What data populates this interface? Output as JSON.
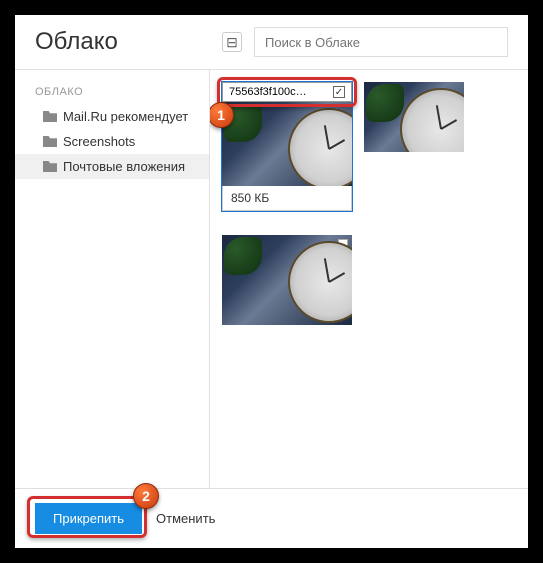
{
  "header": {
    "title": "Облако",
    "collapse_symbol": "⊟",
    "search_placeholder": "Поиск в Облаке"
  },
  "sidebar": {
    "section_label": "ОБЛАКО",
    "items": [
      {
        "label": "Mail.Ru рекомендует"
      },
      {
        "label": "Screenshots"
      },
      {
        "label": "Почтовые вложения"
      }
    ]
  },
  "files": [
    {
      "name": "75563f3f100c…",
      "size": "850 КБ",
      "selected": true
    },
    {
      "name": "",
      "size": "",
      "selected": false
    },
    {
      "name": "",
      "size": "",
      "selected": false
    }
  ],
  "footer": {
    "attach": "Прикрепить",
    "cancel": "Отменить"
  },
  "callouts": {
    "one": "1",
    "two": "2"
  },
  "colors": {
    "primary": "#168de2",
    "highlight": "#d32f2f",
    "callout": "#e8531f"
  }
}
